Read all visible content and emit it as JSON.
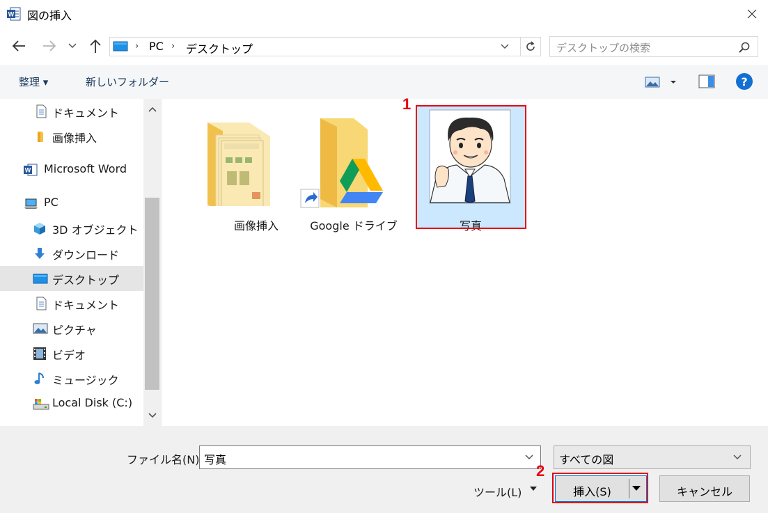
{
  "window": {
    "title": "図の挿入",
    "app_icon": "word-icon",
    "close": "close-icon"
  },
  "nav": {
    "back": "back-arrow-icon",
    "forward": "forward-arrow-icon",
    "recent": "chevron-down-icon",
    "up": "up-arrow-icon"
  },
  "address": {
    "segments": [
      "PC",
      "デスクトップ"
    ]
  },
  "search": {
    "placeholder": "デスクトップの検索"
  },
  "toolbar": {
    "organize": "整理 ▾",
    "new_folder": "新しいフォルダー"
  },
  "sidebar": {
    "items": [
      {
        "label": "ドキュメント",
        "icon": "document-icon"
      },
      {
        "label": "画像挿入",
        "icon": "folder-icon"
      },
      {
        "label": "Microsoft Word",
        "icon": "word-icon"
      },
      {
        "label": "PC",
        "icon": "pc-icon"
      },
      {
        "label": "3D オブジェクト",
        "icon": "cube-icon"
      },
      {
        "label": "ダウンロード",
        "icon": "download-icon"
      },
      {
        "label": "デスクトップ",
        "icon": "desktop-icon"
      },
      {
        "label": "ドキュメント",
        "icon": "document-icon"
      },
      {
        "label": "ピクチャ",
        "icon": "picture-icon"
      },
      {
        "label": "ビデオ",
        "icon": "video-icon"
      },
      {
        "label": "ミュージック",
        "icon": "music-icon"
      },
      {
        "label": "Local Disk (C:)",
        "icon": "disk-icon"
      }
    ]
  },
  "files": [
    {
      "name": "画像挿入",
      "type": "folder"
    },
    {
      "name": "Google ドライブ",
      "type": "shortcut-folder"
    },
    {
      "name": "写真",
      "type": "image"
    }
  ],
  "annotations": {
    "one": "1",
    "two": "2"
  },
  "bottom": {
    "filename_label": "ファイル名(N):",
    "filename_value": "写真",
    "filetype": "すべての図",
    "tools": "ツール(L)",
    "insert": "挿入(S)",
    "cancel": "キャンセル"
  },
  "colors": {
    "accent": "#0078d7",
    "selection": "#cce8ff",
    "annotation": "#e60012",
    "help": "#1370d3"
  }
}
